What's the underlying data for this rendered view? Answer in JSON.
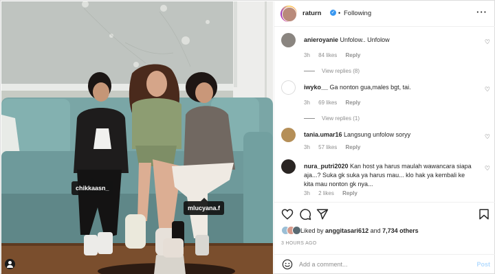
{
  "photo": {
    "tags": [
      "chikkaasn_",
      "mlucyana.f"
    ]
  },
  "header": {
    "username": "raturn",
    "verified_icon": "verified-badge-icon",
    "separator": "•",
    "follow_status": "Following",
    "more_icon": "more-options-icon"
  },
  "comments": [
    {
      "username": "anieroyanie",
      "text": "Unfolow.. Unfolow",
      "time": "3h",
      "likes": "84 likes",
      "reply": "Reply",
      "view_replies": "View replies (8)"
    },
    {
      "username": "iwyko__",
      "text": "Ga nonton gua,males bgt, tai.",
      "time": "3h",
      "likes": "69 likes",
      "reply": "Reply",
      "view_replies": "View replies (1)"
    },
    {
      "username": "tania.umar16",
      "text": "Langsung unfolow soryy",
      "time": "3h",
      "likes": "57 likes",
      "reply": "Reply"
    },
    {
      "username": "nura_putri2020",
      "text": "Kan host ya harus maulah wawancara siapa aja...? Suka gk suka ya harus mau... klo hak ya kembali ke kita mau nonton gk nya...",
      "time": "3h",
      "likes": "2 likes",
      "reply": "Reply"
    }
  ],
  "actions": {
    "icons": [
      "heart-icon",
      "comment-icon",
      "share-icon",
      "bookmark-icon"
    ],
    "liked_by_prefix": "Liked by",
    "liked_by_user": "anggitasari612",
    "liked_by_and": "and",
    "liked_by_others": "7,734 others",
    "time_ago": "3 HOURS AGO"
  },
  "add_comment": {
    "placeholder": "Add a comment...",
    "post_label": "Post"
  },
  "colors": {
    "link_blue": "#0095f6",
    "post_disabled": "#b3dbff",
    "muted": "#8e8e8e",
    "text": "#262626"
  }
}
